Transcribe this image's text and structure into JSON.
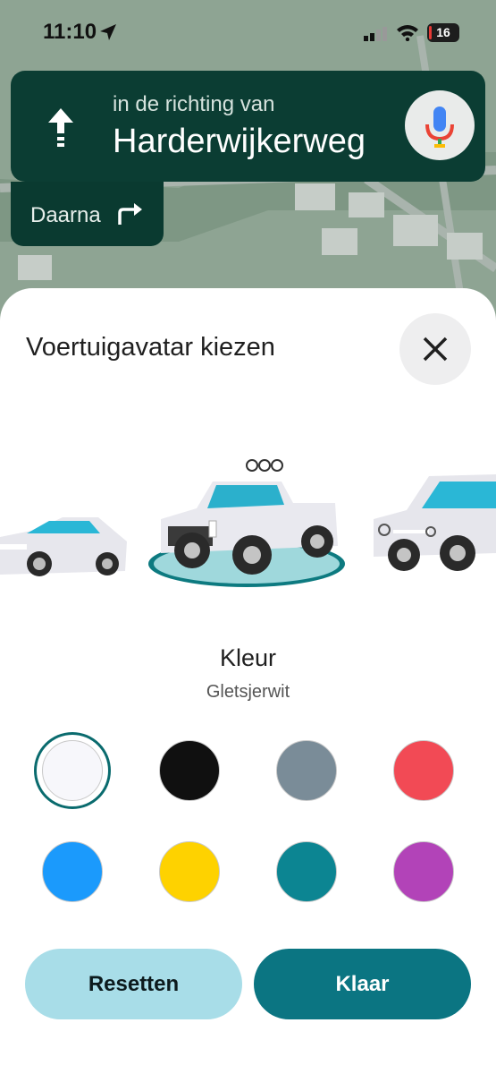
{
  "status_bar": {
    "time": "11:10",
    "battery": "16"
  },
  "navigation": {
    "toward_label": "in de richting van",
    "street": "Harderwijkerweg",
    "then_label": "Daarna"
  },
  "sheet": {
    "title": "Voertuigavatar kiezen",
    "vehicles": [
      "sedan",
      "pickup",
      "suv"
    ],
    "selected_vehicle": "pickup",
    "color_section_title": "Kleur",
    "selected_color_name": "Gletsjerwit",
    "colors": [
      "#f7f7fb",
      "#101010",
      "#7a8c98",
      "#f24a55",
      "#1b9afc",
      "#fed200",
      "#0c8592",
      "#b243b8"
    ],
    "selected_color_index": 0,
    "reset_label": "Resetten",
    "done_label": "Klaar"
  }
}
